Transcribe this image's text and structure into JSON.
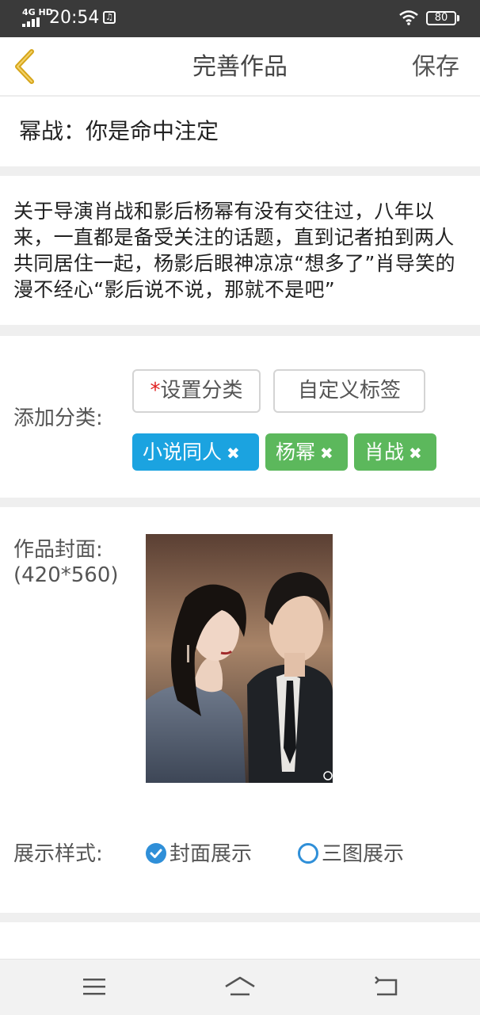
{
  "status_bar": {
    "network": "4G HD",
    "time": "20:54",
    "battery": "80"
  },
  "nav": {
    "title": "完善作品",
    "save_label": "保存"
  },
  "work": {
    "title": "幂战：你是命中注定",
    "description": "关于导演肖战和影后杨幂有没有交往过，八年以来，一直都是备受关注的话题，直到记者拍到两人共同居住一起，杨影后眼神凉凉“想多了”肖导笑的漫不经心“影后说不说，那就不是吧”"
  },
  "category": {
    "label": "添加分类:",
    "required_mark": "*",
    "set_category_label": "设置分类",
    "custom_tag_label": "自定义标签",
    "tags": [
      {
        "label": "小说同人",
        "color": "#1ba3e0"
      },
      {
        "label": "杨幂",
        "color": "#5cb85c"
      },
      {
        "label": "肖战",
        "color": "#5cb85c"
      }
    ],
    "remove_glyph": "✖"
  },
  "cover": {
    "label": "作品封面:",
    "size_hint": "(420*560)"
  },
  "display_style": {
    "label": "展示样式:",
    "options": [
      {
        "label": "封面展示",
        "selected": true
      },
      {
        "label": "三图展示",
        "selected": false
      }
    ]
  },
  "colors": {
    "accent_blue": "#2f8fd8",
    "tag_blue": "#1ba3e0",
    "tag_green": "#5cb85c",
    "back_arrow": "#d6a51a",
    "required_red": "#e02020"
  },
  "icons": {
    "back": "chevron-left-icon",
    "menu": "menu-icon",
    "home": "home-icon",
    "return": "return-icon"
  }
}
